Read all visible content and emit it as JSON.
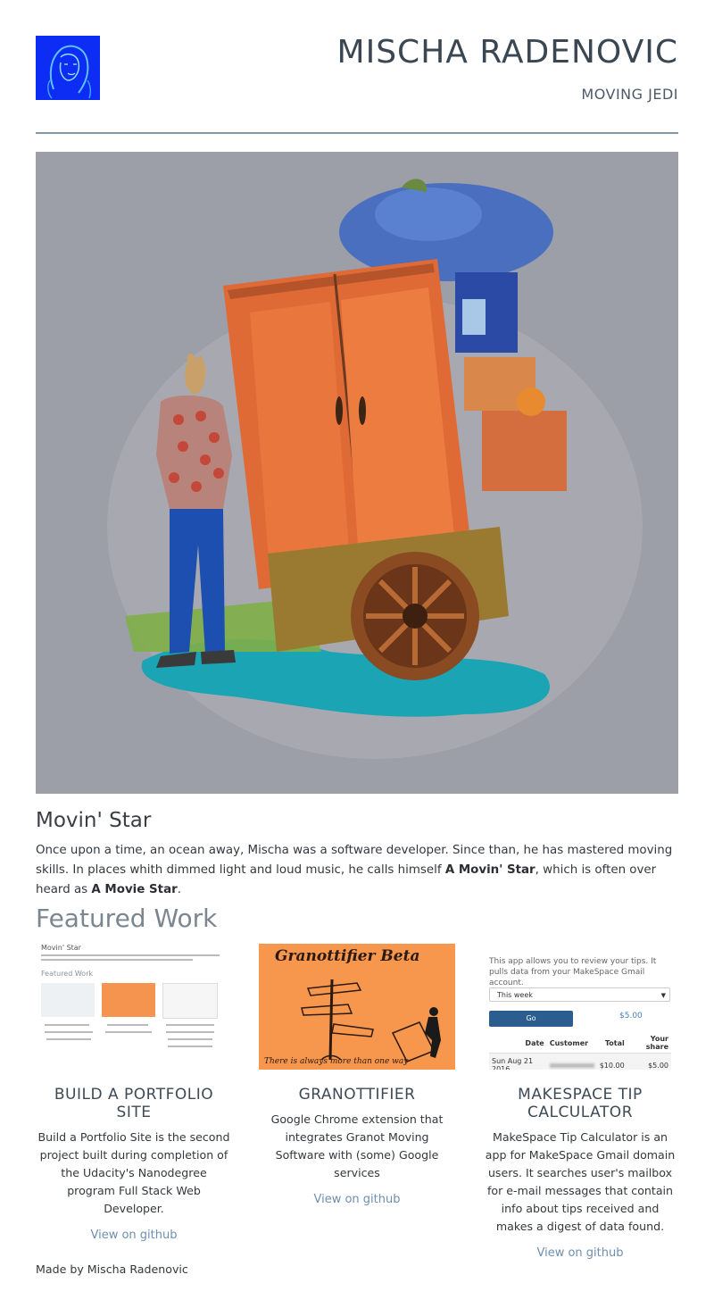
{
  "header": {
    "name": "MISCHA RADENOVIC",
    "tagline": "MOVING JEDI"
  },
  "intro": {
    "heading": "Movin' Star",
    "text_before": "Once upon a time, an ocean away, Mischa was a software developer. Since than, he has mastered moving skills. In places whith dimmed light and loud music, he calls himself ",
    "bold1": "A Movin' Star",
    "text_middle": ", which is often over heard as ",
    "bold2": "A Movie Star",
    "text_after": "."
  },
  "featured": {
    "heading": "Featured Work",
    "works": [
      {
        "title": "BUILD A PORTFOLIO SITE",
        "description": "Build a Portfolio Site is the second project built during completion of the Udacity's Nanodegree program Full Stack Web Developer.",
        "link": "View on github",
        "thumb_heading": "Movin' Star",
        "thumb_featured": "Featured Work"
      },
      {
        "title": "GRANOTTIFIER",
        "description": "Google Chrome extension that integrates Granot Moving Software with (some) Google services",
        "link": "View on github",
        "thumb_title": "Granottifier Beta",
        "thumb_caption": "There is always more than one way"
      },
      {
        "title": "MAKESPACE TIP CALCULATOR",
        "description": "MakeSpace Tip Calculator is an app for MakeSpace Gmail domain users. It searches user's mailbox for e-mail messages that contain info about tips received and makes a digest of data found.",
        "link": "View on github",
        "thumb": {
          "intro": "This app allows you to review your tips. It pulls data from your MakeSpace Gmail account.",
          "select_value": "This week",
          "go_label": "Go",
          "amount": "$5.00",
          "columns": [
            "Date",
            "Customer",
            "Total",
            "Your share"
          ],
          "row": [
            "Sun Aug 21 2016",
            "",
            "$10.00",
            "$5.00"
          ]
        }
      }
    ]
  },
  "footer": {
    "text": "Made by Mischa Radenovic"
  }
}
